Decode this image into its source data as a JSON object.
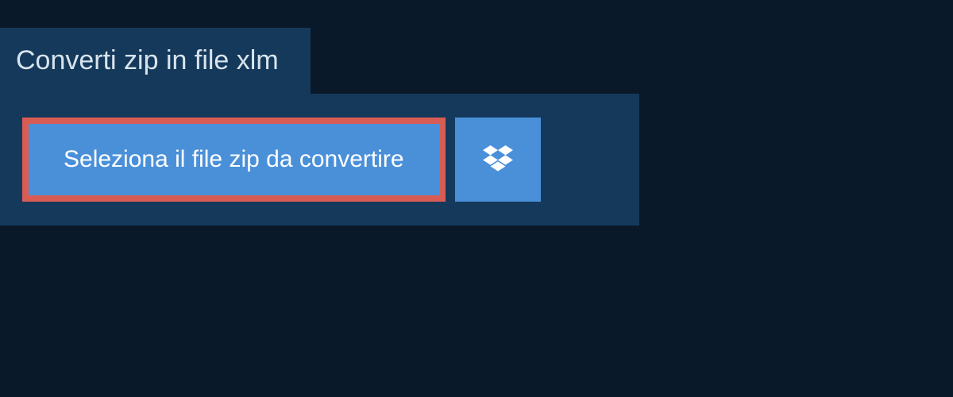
{
  "tab": {
    "title": "Converti zip in file xlm"
  },
  "actions": {
    "select_file_label": "Seleziona il file zip da convertire"
  }
}
